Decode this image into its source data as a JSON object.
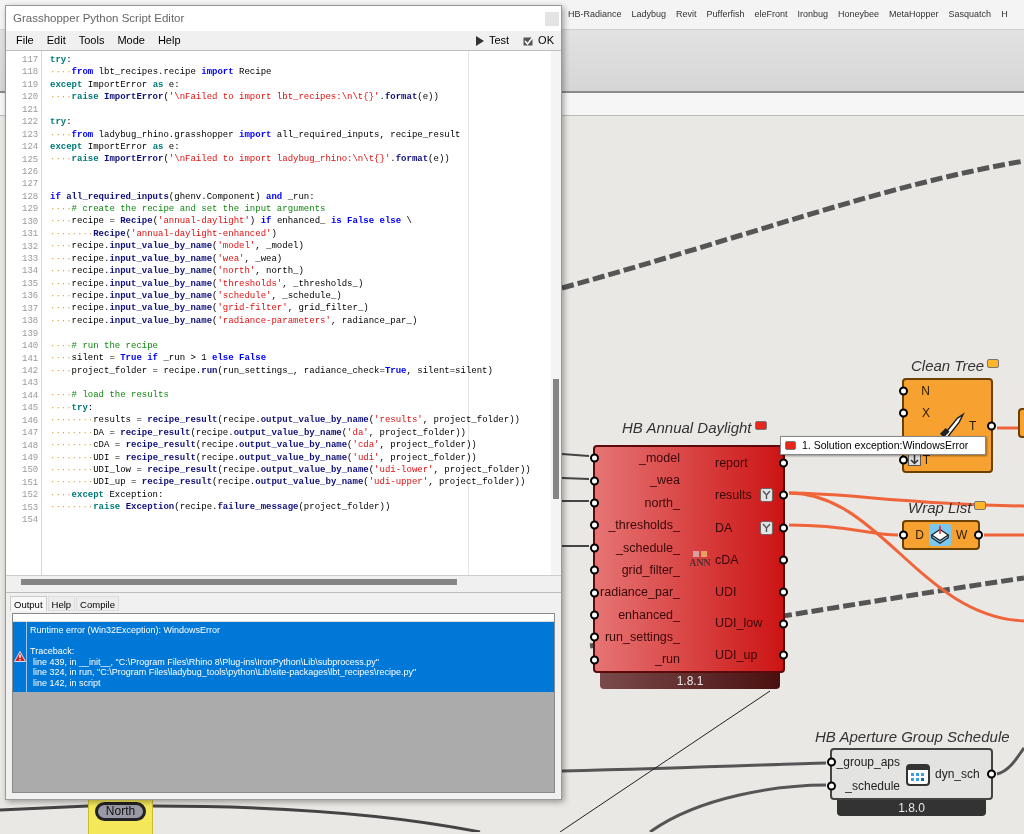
{
  "ribbon": {
    "tabs": [
      "HB-Radiance",
      "Ladybug",
      "Revit",
      "Pufferfish",
      "eleFront",
      "Ironbug",
      "Honeybee",
      "MetaHopper",
      "Sasquatch",
      "H"
    ]
  },
  "editor": {
    "title": "Grasshopper Python Script Editor",
    "menu": [
      "File",
      "Edit",
      "Tools",
      "Mode",
      "Help"
    ],
    "actions": [
      {
        "kind": "run",
        "label": "Test"
      },
      {
        "kind": "accept",
        "label": "OK"
      }
    ],
    "code_lines": [
      {
        "number": "117",
        "tokens": [
          {
            "kind": "ctl",
            "text": "try"
          },
          {
            "kind": "tx",
            "text": ":"
          }
        ]
      },
      {
        "number": "118",
        "tokens": [
          {
            "kind": "ws",
            "text": "····"
          },
          {
            "kind": "kw",
            "text": "from"
          },
          {
            "kind": "tx",
            "text": " lbt_recipes.recipe "
          },
          {
            "kind": "kw",
            "text": "import"
          },
          {
            "kind": "tx",
            "text": " Recipe"
          }
        ]
      },
      {
        "number": "119",
        "tokens": [
          {
            "kind": "ctl",
            "text": "except"
          },
          {
            "kind": "tx",
            "text": " ImportError "
          },
          {
            "kind": "ctl",
            "text": "as"
          },
          {
            "kind": "tx",
            "text": " e:"
          }
        ]
      },
      {
        "number": "120",
        "tokens": [
          {
            "kind": "ws",
            "text": "····"
          },
          {
            "kind": "ctl",
            "text": "raise "
          },
          {
            "kind": "fn",
            "text": "ImportError"
          },
          {
            "kind": "tx",
            "text": "("
          },
          {
            "kind": "str",
            "text": "'\\nFailed to import lbt_recipes:\\n\\t{}'"
          },
          {
            "kind": "tx",
            "text": "."
          },
          {
            "kind": "fn",
            "text": "format"
          },
          {
            "kind": "tx",
            "text": "(e))"
          }
        ]
      },
      {
        "number": "121"
      },
      {
        "number": "122",
        "tokens": [
          {
            "kind": "ctl",
            "text": "try"
          },
          {
            "kind": "tx",
            "text": ":"
          }
        ]
      },
      {
        "number": "123",
        "tokens": [
          {
            "kind": "ws",
            "text": "····"
          },
          {
            "kind": "kw",
            "text": "from"
          },
          {
            "kind": "tx",
            "text": " ladybug_rhino.grasshopper "
          },
          {
            "kind": "kw",
            "text": "import"
          },
          {
            "kind": "tx",
            "text": " all_required_inputs, recipe_result"
          }
        ]
      },
      {
        "number": "124",
        "tokens": [
          {
            "kind": "ctl",
            "text": "except"
          },
          {
            "kind": "tx",
            "text": " ImportError "
          },
          {
            "kind": "ctl",
            "text": "as"
          },
          {
            "kind": "tx",
            "text": " e:"
          }
        ]
      },
      {
        "number": "125",
        "tokens": [
          {
            "kind": "ws",
            "text": "····"
          },
          {
            "kind": "ctl",
            "text": "raise "
          },
          {
            "kind": "fn",
            "text": "ImportError"
          },
          {
            "kind": "tx",
            "text": "("
          },
          {
            "kind": "str",
            "text": "'\\nFailed to import ladybug_rhino:\\n\\t{}'"
          },
          {
            "kind": "tx",
            "text": "."
          },
          {
            "kind": "fn",
            "text": "format"
          },
          {
            "kind": "tx",
            "text": "(e))"
          }
        ]
      },
      {
        "number": "126"
      },
      {
        "number": "127"
      },
      {
        "number": "128",
        "tokens": [
          {
            "kind": "kw",
            "text": "if "
          },
          {
            "kind": "fn",
            "text": "all_required_inputs"
          },
          {
            "kind": "tx",
            "text": "(ghenv.Component) "
          },
          {
            "kind": "kw",
            "text": "and"
          },
          {
            "kind": "tx",
            "text": " _run:"
          }
        ]
      },
      {
        "number": "129",
        "tokens": [
          {
            "kind": "ws",
            "text": "····"
          },
          {
            "kind": "com",
            "text": "# create the recipe and set the input arguments"
          }
        ]
      },
      {
        "number": "130",
        "tokens": [
          {
            "kind": "ws",
            "text": "····"
          },
          {
            "kind": "tx",
            "text": "recipe = "
          },
          {
            "kind": "fn",
            "text": "Recipe"
          },
          {
            "kind": "tx",
            "text": "("
          },
          {
            "kind": "str",
            "text": "'annual-daylight'"
          },
          {
            "kind": "tx",
            "text": ") "
          },
          {
            "kind": "kw",
            "text": "if"
          },
          {
            "kind": "tx",
            "text": " enhanced_ "
          },
          {
            "kind": "kw",
            "text": "is False else"
          },
          {
            "kind": "tx",
            "text": " \\"
          }
        ]
      },
      {
        "number": "131",
        "tokens": [
          {
            "kind": "ws",
            "text": "········"
          },
          {
            "kind": "fn",
            "text": "Recipe"
          },
          {
            "kind": "tx",
            "text": "("
          },
          {
            "kind": "str",
            "text": "'annual-daylight-enhanced'"
          },
          {
            "kind": "tx",
            "text": ")"
          }
        ]
      },
      {
        "number": "132",
        "tokens": [
          {
            "kind": "ws",
            "text": "····"
          },
          {
            "kind": "tx",
            "text": "recipe."
          },
          {
            "kind": "fn",
            "text": "input_value_by_name"
          },
          {
            "kind": "tx",
            "text": "("
          },
          {
            "kind": "str",
            "text": "'model'"
          },
          {
            "kind": "tx",
            "text": ", _model)"
          }
        ]
      },
      {
        "number": "133",
        "tokens": [
          {
            "kind": "ws",
            "text": "····"
          },
          {
            "kind": "tx",
            "text": "recipe."
          },
          {
            "kind": "fn",
            "text": "input_value_by_name"
          },
          {
            "kind": "tx",
            "text": "("
          },
          {
            "kind": "str",
            "text": "'wea'"
          },
          {
            "kind": "tx",
            "text": ", _wea)"
          }
        ]
      },
      {
        "number": "134",
        "tokens": [
          {
            "kind": "ws",
            "text": "····"
          },
          {
            "kind": "tx",
            "text": "recipe."
          },
          {
            "kind": "fn",
            "text": "input_value_by_name"
          },
          {
            "kind": "tx",
            "text": "("
          },
          {
            "kind": "str",
            "text": "'north'"
          },
          {
            "kind": "tx",
            "text": ", north_)"
          }
        ]
      },
      {
        "number": "135",
        "tokens": [
          {
            "kind": "ws",
            "text": "····"
          },
          {
            "kind": "tx",
            "text": "recipe."
          },
          {
            "kind": "fn",
            "text": "input_value_by_name"
          },
          {
            "kind": "tx",
            "text": "("
          },
          {
            "kind": "str",
            "text": "'thresholds'"
          },
          {
            "kind": "tx",
            "text": ", _thresholds_)"
          }
        ]
      },
      {
        "number": "136",
        "tokens": [
          {
            "kind": "ws",
            "text": "····"
          },
          {
            "kind": "tx",
            "text": "recipe."
          },
          {
            "kind": "fn",
            "text": "input_value_by_name"
          },
          {
            "kind": "tx",
            "text": "("
          },
          {
            "kind": "str",
            "text": "'schedule'"
          },
          {
            "kind": "tx",
            "text": ", _schedule_)"
          }
        ]
      },
      {
        "number": "137",
        "tokens": [
          {
            "kind": "ws",
            "text": "····"
          },
          {
            "kind": "tx",
            "text": "recipe."
          },
          {
            "kind": "fn",
            "text": "input_value_by_name"
          },
          {
            "kind": "tx",
            "text": "("
          },
          {
            "kind": "str",
            "text": "'grid-filter'"
          },
          {
            "kind": "tx",
            "text": ", grid_filter_)"
          }
        ]
      },
      {
        "number": "138",
        "tokens": [
          {
            "kind": "ws",
            "text": "····"
          },
          {
            "kind": "tx",
            "text": "recipe."
          },
          {
            "kind": "fn",
            "text": "input_value_by_name"
          },
          {
            "kind": "tx",
            "text": "("
          },
          {
            "kind": "str",
            "text": "'radiance-parameters'"
          },
          {
            "kind": "tx",
            "text": ", radiance_par_)"
          }
        ]
      },
      {
        "number": "139"
      },
      {
        "number": "140",
        "tokens": [
          {
            "kind": "ws",
            "text": "····"
          },
          {
            "kind": "com",
            "text": "# run the recipe"
          }
        ]
      },
      {
        "number": "141",
        "tokens": [
          {
            "kind": "ws",
            "text": "····"
          },
          {
            "kind": "tx",
            "text": "silent = "
          },
          {
            "kind": "kw",
            "text": "True if"
          },
          {
            "kind": "tx",
            "text": " _run > 1 "
          },
          {
            "kind": "kw",
            "text": "else False"
          }
        ]
      },
      {
        "number": "142",
        "tokens": [
          {
            "kind": "ws",
            "text": "····"
          },
          {
            "kind": "tx",
            "text": "project_folder = recipe."
          },
          {
            "kind": "fn",
            "text": "run"
          },
          {
            "kind": "tx",
            "text": "(run_settings_, radiance_check="
          },
          {
            "kind": "kw",
            "text": "True"
          },
          {
            "kind": "tx",
            "text": ", silent=silent)"
          }
        ]
      },
      {
        "number": "143"
      },
      {
        "number": "144",
        "tokens": [
          {
            "kind": "ws",
            "text": "····"
          },
          {
            "kind": "com",
            "text": "# load the results"
          }
        ]
      },
      {
        "number": "145",
        "tokens": [
          {
            "kind": "ws",
            "text": "····"
          },
          {
            "kind": "ctl",
            "text": "try"
          },
          {
            "kind": "tx",
            "text": ":"
          }
        ]
      },
      {
        "number": "146",
        "tokens": [
          {
            "kind": "ws",
            "text": "········"
          },
          {
            "kind": "tx",
            "text": "results = "
          },
          {
            "kind": "fn",
            "text": "recipe_result"
          },
          {
            "kind": "tx",
            "text": "(recipe."
          },
          {
            "kind": "fn",
            "text": "output_value_by_name"
          },
          {
            "kind": "tx",
            "text": "("
          },
          {
            "kind": "str",
            "text": "'results'"
          },
          {
            "kind": "tx",
            "text": ", project_folder))"
          }
        ]
      },
      {
        "number": "147",
        "tokens": [
          {
            "kind": "ws",
            "text": "········"
          },
          {
            "kind": "tx",
            "text": "DA = "
          },
          {
            "kind": "fn",
            "text": "recipe_result"
          },
          {
            "kind": "tx",
            "text": "(recipe."
          },
          {
            "kind": "fn",
            "text": "output_value_by_name"
          },
          {
            "kind": "tx",
            "text": "("
          },
          {
            "kind": "str",
            "text": "'da'"
          },
          {
            "kind": "tx",
            "text": ", project_folder))"
          }
        ]
      },
      {
        "number": "148",
        "tokens": [
          {
            "kind": "ws",
            "text": "········"
          },
          {
            "kind": "tx",
            "text": "cDA = "
          },
          {
            "kind": "fn",
            "text": "recipe_result"
          },
          {
            "kind": "tx",
            "text": "(recipe."
          },
          {
            "kind": "fn",
            "text": "output_value_by_name"
          },
          {
            "kind": "tx",
            "text": "("
          },
          {
            "kind": "str",
            "text": "'cda'"
          },
          {
            "kind": "tx",
            "text": ", project_folder))"
          }
        ]
      },
      {
        "number": "149",
        "tokens": [
          {
            "kind": "ws",
            "text": "········"
          },
          {
            "kind": "tx",
            "text": "UDI = "
          },
          {
            "kind": "fn",
            "text": "recipe_result"
          },
          {
            "kind": "tx",
            "text": "(recipe."
          },
          {
            "kind": "fn",
            "text": "output_value_by_name"
          },
          {
            "kind": "tx",
            "text": "("
          },
          {
            "kind": "str",
            "text": "'udi'"
          },
          {
            "kind": "tx",
            "text": ", project_folder))"
          }
        ]
      },
      {
        "number": "150",
        "tokens": [
          {
            "kind": "ws",
            "text": "········"
          },
          {
            "kind": "tx",
            "text": "UDI_low = "
          },
          {
            "kind": "fn",
            "text": "recipe_result"
          },
          {
            "kind": "tx",
            "text": "(recipe."
          },
          {
            "kind": "fn",
            "text": "output_value_by_name"
          },
          {
            "kind": "tx",
            "text": "("
          },
          {
            "kind": "str",
            "text": "'udi-lower'"
          },
          {
            "kind": "tx",
            "text": ", project_folder))"
          }
        ]
      },
      {
        "number": "151",
        "tokens": [
          {
            "kind": "ws",
            "text": "········"
          },
          {
            "kind": "tx",
            "text": "UDI_up = "
          },
          {
            "kind": "fn",
            "text": "recipe_result"
          },
          {
            "kind": "tx",
            "text": "(recipe."
          },
          {
            "kind": "fn",
            "text": "output_value_by_name"
          },
          {
            "kind": "tx",
            "text": "("
          },
          {
            "kind": "str",
            "text": "'udi-upper'"
          },
          {
            "kind": "tx",
            "text": ", project_folder))"
          }
        ]
      },
      {
        "number": "152",
        "tokens": [
          {
            "kind": "ws",
            "text": "····"
          },
          {
            "kind": "ctl",
            "text": "except"
          },
          {
            "kind": "tx",
            "text": " Exception:"
          }
        ]
      },
      {
        "number": "153",
        "tokens": [
          {
            "kind": "ws",
            "text": "········"
          },
          {
            "kind": "ctl",
            "text": "raise "
          },
          {
            "kind": "fn",
            "text": "Exception"
          },
          {
            "kind": "tx",
            "text": "(recipe."
          },
          {
            "kind": "fn",
            "text": "failure_message"
          },
          {
            "kind": "tx",
            "text": "(project_folder))"
          }
        ]
      },
      {
        "number": "154"
      }
    ],
    "output_tabs": [
      {
        "label": "Output",
        "selected": true
      },
      {
        "label": "Help",
        "selected": false
      },
      {
        "label": "Compile",
        "selected": false
      }
    ],
    "messages": [
      {
        "error": true,
        "selected": true,
        "lines": [
          "Runtime error (Win32Exception): WindowsError",
          "Traceback:",
          "line 439, in __init__, \"C:\\Program Files\\Rhino 8\\Plug-ins\\IronPython\\Lib\\subprocess.py\"",
          "line 324, in run, \"C:\\Program Files\\ladybug_tools\\python\\Lib\\site-packages\\lbt_recipes\\recipe.py\"",
          "line 142, in script"
        ]
      }
    ]
  },
  "canvas": {
    "nodes": [
      {
        "kind": "component",
        "error": false,
        "warning": true,
        "title": "Clean Tree",
        "inputs": [
          {
            "label": "N",
            "flipped": false
          },
          {
            "label": "X",
            "flipped": false
          },
          {
            "label": "T",
            "flipped": true
          }
        ],
        "outputs": [
          {
            "label": "T"
          }
        ]
      },
      {
        "kind": "partial",
        "error": false,
        "warning": true
      },
      {
        "kind": "component",
        "error": true,
        "warning": false,
        "title": "HB Annual Daylight",
        "icon_label": "ANN",
        "version": "1.8.1",
        "message": "1. Solution exception:WindowsError",
        "inputs": [
          {
            "label": "_model"
          },
          {
            "label": "_wea"
          },
          {
            "label": "north_"
          },
          {
            "label": "_thresholds_"
          },
          {
            "label": "_schedule_"
          },
          {
            "label": "grid_filter_"
          },
          {
            "label": "radiance_par_"
          },
          {
            "label": "enhanced_"
          },
          {
            "label": "run_settings_"
          },
          {
            "label": "_run"
          }
        ],
        "outputs": [
          {
            "label": "report",
            "grafted": false
          },
          {
            "label": "results",
            "grafted": true
          },
          {
            "label": "DA",
            "grafted": true
          },
          {
            "label": "cDA",
            "grafted": false
          },
          {
            "label": "UDI",
            "grafted": false
          },
          {
            "label": "UDI_low",
            "grafted": false
          },
          {
            "label": "UDI_up",
            "grafted": false
          }
        ]
      },
      {
        "kind": "component",
        "error": false,
        "warning": true,
        "title": "Wrap List",
        "inputs": [
          {
            "label": "D"
          }
        ],
        "outputs": [
          {
            "label": "W"
          }
        ]
      },
      {
        "kind": "component",
        "error": false,
        "warning": false,
        "title": "HB Aperture Group Schedule",
        "version": "1.8.0",
        "inputs": [
          {
            "label": "_group_aps"
          },
          {
            "label": "_schedule"
          }
        ],
        "outputs": [
          {
            "label": "dyn_sch"
          }
        ]
      }
    ],
    "groups": [
      {
        "label": "North"
      }
    ]
  }
}
